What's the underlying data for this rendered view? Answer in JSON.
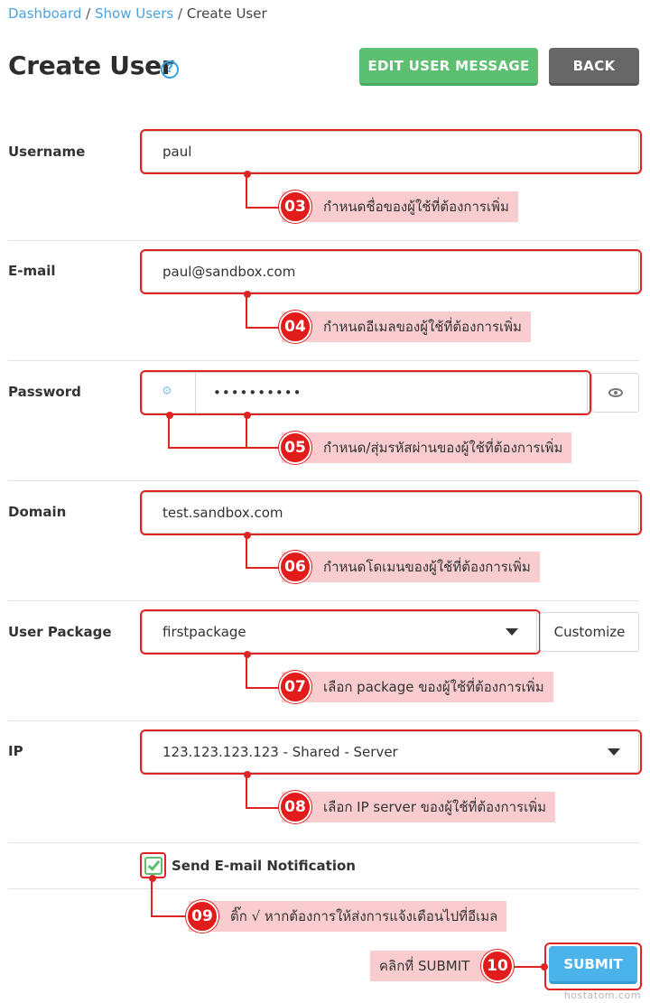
{
  "breadcrumb": {
    "dashboard": "Dashboard",
    "sep1": " / ",
    "show_users": "Show Users",
    "sep2": " / ",
    "current": "Create User"
  },
  "header": {
    "title": "Create User",
    "help_icon": "?",
    "edit_message_label": "EDIT USER MESSAGE",
    "back_label": "BACK"
  },
  "form": {
    "username": {
      "label": "Username",
      "value": "paul"
    },
    "email": {
      "label": "E-mail",
      "value": "paul@sandbox.com"
    },
    "password": {
      "label": "Password",
      "value": "••••••••••",
      "generate_icon": "generate-password-icon",
      "toggle_icon": "eye-icon"
    },
    "domain": {
      "label": "Domain",
      "value": "test.sandbox.com"
    },
    "package": {
      "label": "User Package",
      "value": "firstpackage",
      "customize_label": "Customize"
    },
    "ip": {
      "label": "IP",
      "value": "123.123.123.123 - Shared - Server"
    },
    "notify": {
      "label": "Send E-mail Notification",
      "checked": true
    },
    "submit_label": "SUBMIT"
  },
  "callouts": [
    {
      "num": "03",
      "text": "กำหนดชื่อของผู้ใช้ที่ต้องการเพิ่ม"
    },
    {
      "num": "04",
      "text": "กำหนดอีเมลของผู้ใช้ที่ต้องการเพิ่ม"
    },
    {
      "num": "05",
      "text": "กำหนด/สุ่มรหัสผ่านของผู้ใช้ที่ต้องการเพิ่ม"
    },
    {
      "num": "06",
      "text": "กำหนดโดเมนของผู้ใช้ที่ต้องการเพิ่ม"
    },
    {
      "num": "07",
      "text": "เลือก package ของผู้ใช้ที่ต้องการเพิ่ม"
    },
    {
      "num": "08",
      "text": "เลือก IP server ของผู้ใช้ที่ต้องการเพิ่ม"
    },
    {
      "num": "09",
      "text": "ติ๊ก √ หากต้องการให้ส่งการแจ้งเตือนไปที่อีเมล"
    },
    {
      "num": "10",
      "text": "คลิกที่ SUBMIT"
    }
  ],
  "watermark": "hostatom.com",
  "colors": {
    "annotation_red": "#e02424",
    "callout_pink": "#f9cdd0",
    "link_blue": "#4aa3df",
    "green": "#5cbf72",
    "submit_blue": "#4ab4ea"
  }
}
